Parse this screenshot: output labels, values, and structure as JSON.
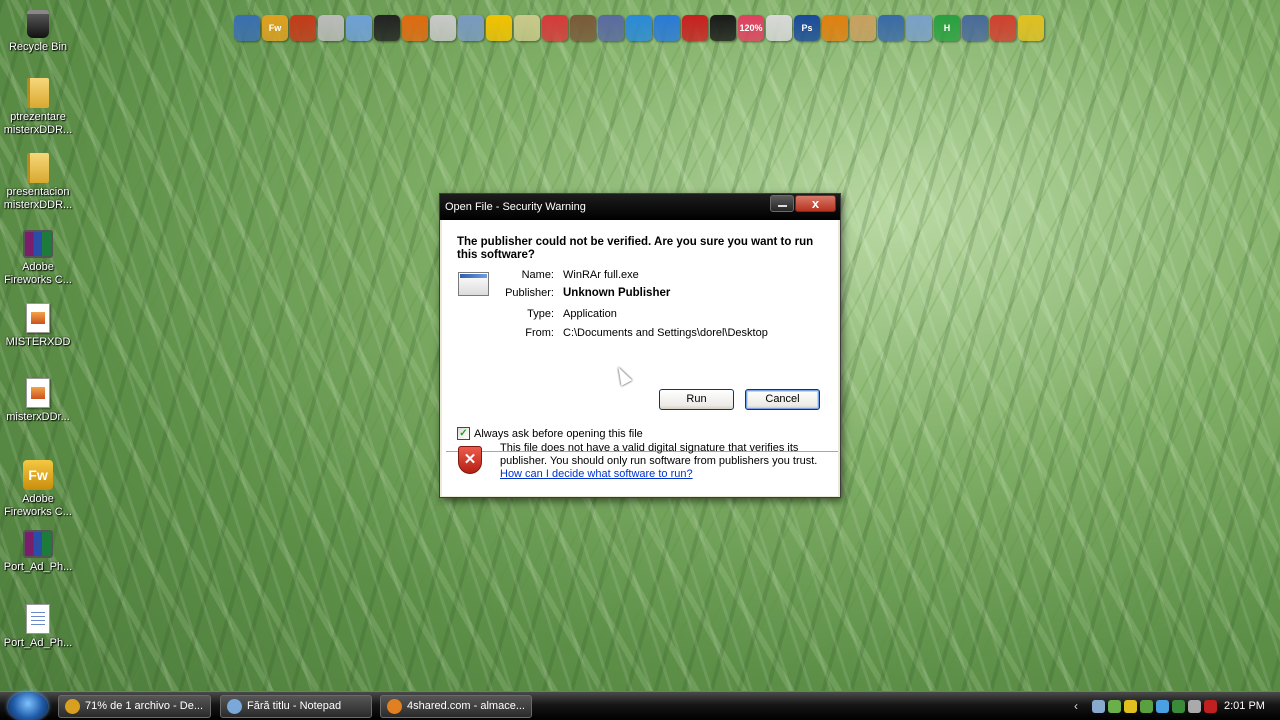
{
  "desktop": {
    "icons": [
      {
        "label": "Recycle Bin",
        "icon": "recycle-bin-icon"
      },
      {
        "label": "ptrezentare misterxDDR...",
        "line1": "ptrezentare",
        "line2": "misterxDDR...",
        "icon": "folder-icon"
      },
      {
        "label": "presentacion misterxDDR...",
        "line1": "presentacion",
        "line2": "misterxDDR...",
        "icon": "folder-icon"
      },
      {
        "label": "Adobe Fireworks C...",
        "line1": "Adobe",
        "line2": "Fireworks C...",
        "icon": "winrar-archive-icon"
      },
      {
        "label": "MISTERXDD",
        "icon": "image-file-icon"
      },
      {
        "label": "misterxDDr...",
        "icon": "image-file-icon"
      },
      {
        "label": "Adobe Fireworks C...",
        "line1": "Adobe",
        "line2": "Fireworks C...",
        "icon": "fireworks-icon"
      },
      {
        "label": "Port_Ad_Ph...",
        "icon": "winrar-archive-icon"
      },
      {
        "label": "Port_Ad_Ph...",
        "icon": "text-file-icon"
      }
    ]
  },
  "launch_bar": {
    "fw_text": "Fw",
    "ps_text": "Ps",
    "h_text": "H",
    "count_text": "120%",
    "colors": [
      "#3a6fb0",
      "#e0a020",
      "#c43a1a",
      "#bbbbbb",
      "#6fa0d8",
      "#222222",
      "#e06a10",
      "#c8c8c8",
      "#7a9ac0",
      "#f2c200",
      "#c9c98a",
      "#d63a3a",
      "#7a5a3a",
      "#5a6aa0",
      "#2a8ad8",
      "#2a7ad8",
      "#c82020",
      "#1a1a1a",
      "#e04060",
      "#d8d8d8",
      "#1a4a9a",
      "#e08010",
      "#c8a060",
      "#3a6aa8",
      "#7aa0c8",
      "#2aa040",
      "#4a6a9a",
      "#d04030",
      "#e0c020"
    ]
  },
  "dialog": {
    "title": "Open File - Security Warning",
    "close_glyph": "x",
    "question": "The publisher could not be verified.  Are you sure you want to run this software?",
    "fields": {
      "name_label": "Name:",
      "name_value": "WinRAr full.exe",
      "publisher_label": "Publisher:",
      "publisher_value": "Unknown Publisher",
      "type_label": "Type:",
      "type_value": "Application",
      "from_label": "From:",
      "from_value": "C:\\Documents and Settings\\dorel\\Desktop"
    },
    "run_label": "Run",
    "cancel_label": "Cancel",
    "checkbox_label": "Always ask before opening this file",
    "checkbox_checked": true,
    "warning_text": "This file does not have a valid digital signature that verifies its publisher.  You should only run software from publishers you trust.",
    "warning_link": "How can I decide what software to run?"
  },
  "taskbar": {
    "buttons": [
      {
        "label": "71% de 1 archivo - De...",
        "color": "#d8a020"
      },
      {
        "label": "Fără titlu - Notepad",
        "color": "#7aa8d8"
      },
      {
        "label": "4shared.com - almace...",
        "color": "#e08020"
      }
    ],
    "tray_icons": [
      "#88aacc",
      "#6ab04a",
      "#e0c020",
      "#5aa040",
      "#4aa0e0",
      "#3a8a3a",
      "#aaaaaa",
      "#c02020"
    ],
    "clock": "2:01 PM"
  }
}
